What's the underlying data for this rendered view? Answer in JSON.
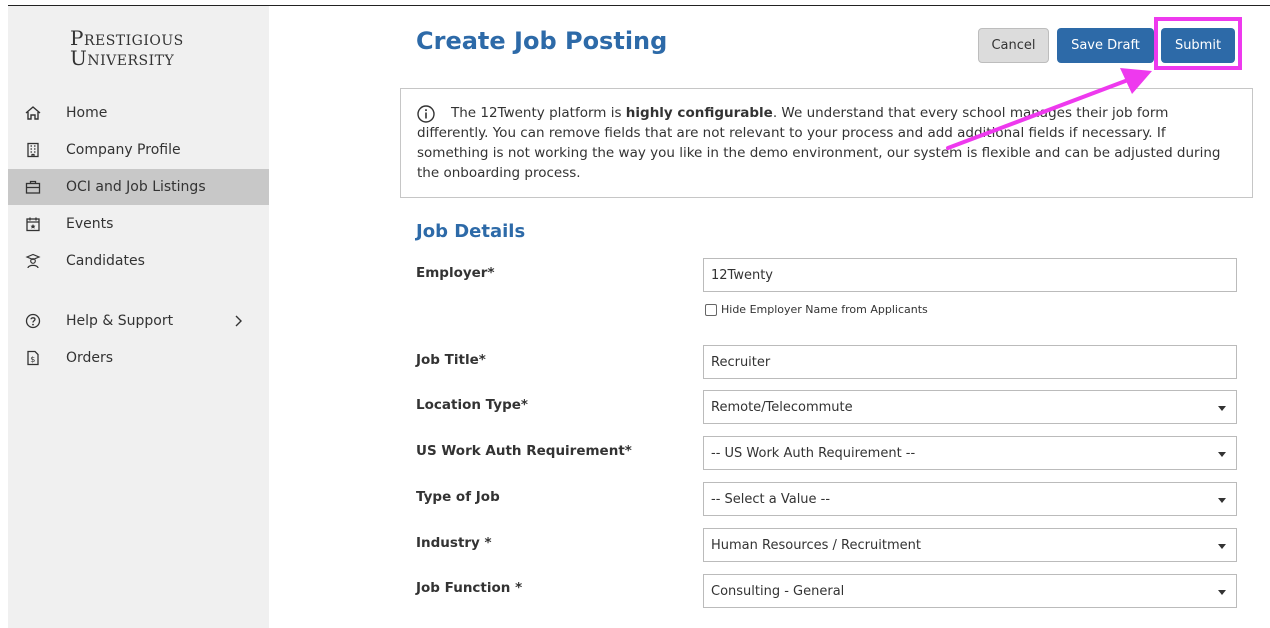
{
  "sidebar": {
    "logo_line1": "Prestigious",
    "logo_line2": "University",
    "items": [
      {
        "label": "Home",
        "icon": "home-icon"
      },
      {
        "label": "Company Profile",
        "icon": "building-icon"
      },
      {
        "label": "OCI and Job Listings",
        "icon": "briefcase-icon",
        "active": true
      },
      {
        "label": "Events",
        "icon": "calendar-icon"
      },
      {
        "label": "Candidates",
        "icon": "candidates-icon"
      },
      {
        "label": "Help & Support",
        "icon": "help-icon"
      },
      {
        "label": "Orders",
        "icon": "orders-icon"
      }
    ]
  },
  "header": {
    "title": "Create Job Posting",
    "cancel_label": "Cancel",
    "save_draft_label": "Save Draft",
    "submit_label": "Submit"
  },
  "info": {
    "text_before_bold": "The 12Twenty platform is ",
    "bold_text": "highly configurable",
    "text_after_bold": ". We understand that every school manages their job form differently. You can remove fields that are not relevant to your process and add additional fields if necessary. If something is not working the way you like in the demo environment, our system is flexible and can be adjusted during the onboarding process."
  },
  "job_details": {
    "section_title": "Job Details",
    "employer_label": "Employer*",
    "employer_value": "12Twenty",
    "hide_employer_label": "Hide Employer Name from Applicants",
    "job_title_label": "Job Title*",
    "job_title_value": "Recruiter",
    "location_type_label": "Location Type*",
    "location_type_value": "Remote/Telecommute",
    "work_auth_label": "US Work Auth Requirement*",
    "work_auth_value": "-- US Work Auth Requirement --",
    "type_of_job_label": "Type of Job",
    "type_of_job_value": "-- Select a Value --",
    "industry_label": "Industry *",
    "industry_value": "Human Resources / Recruitment",
    "job_function_label": "Job Function *",
    "job_function_value": "Consulting - General"
  },
  "colors": {
    "accent": "#2d6aa8",
    "highlight": "#ee39ee",
    "sidebar_bg": "#f0f0f0",
    "active_bg": "#c8c8c8"
  }
}
